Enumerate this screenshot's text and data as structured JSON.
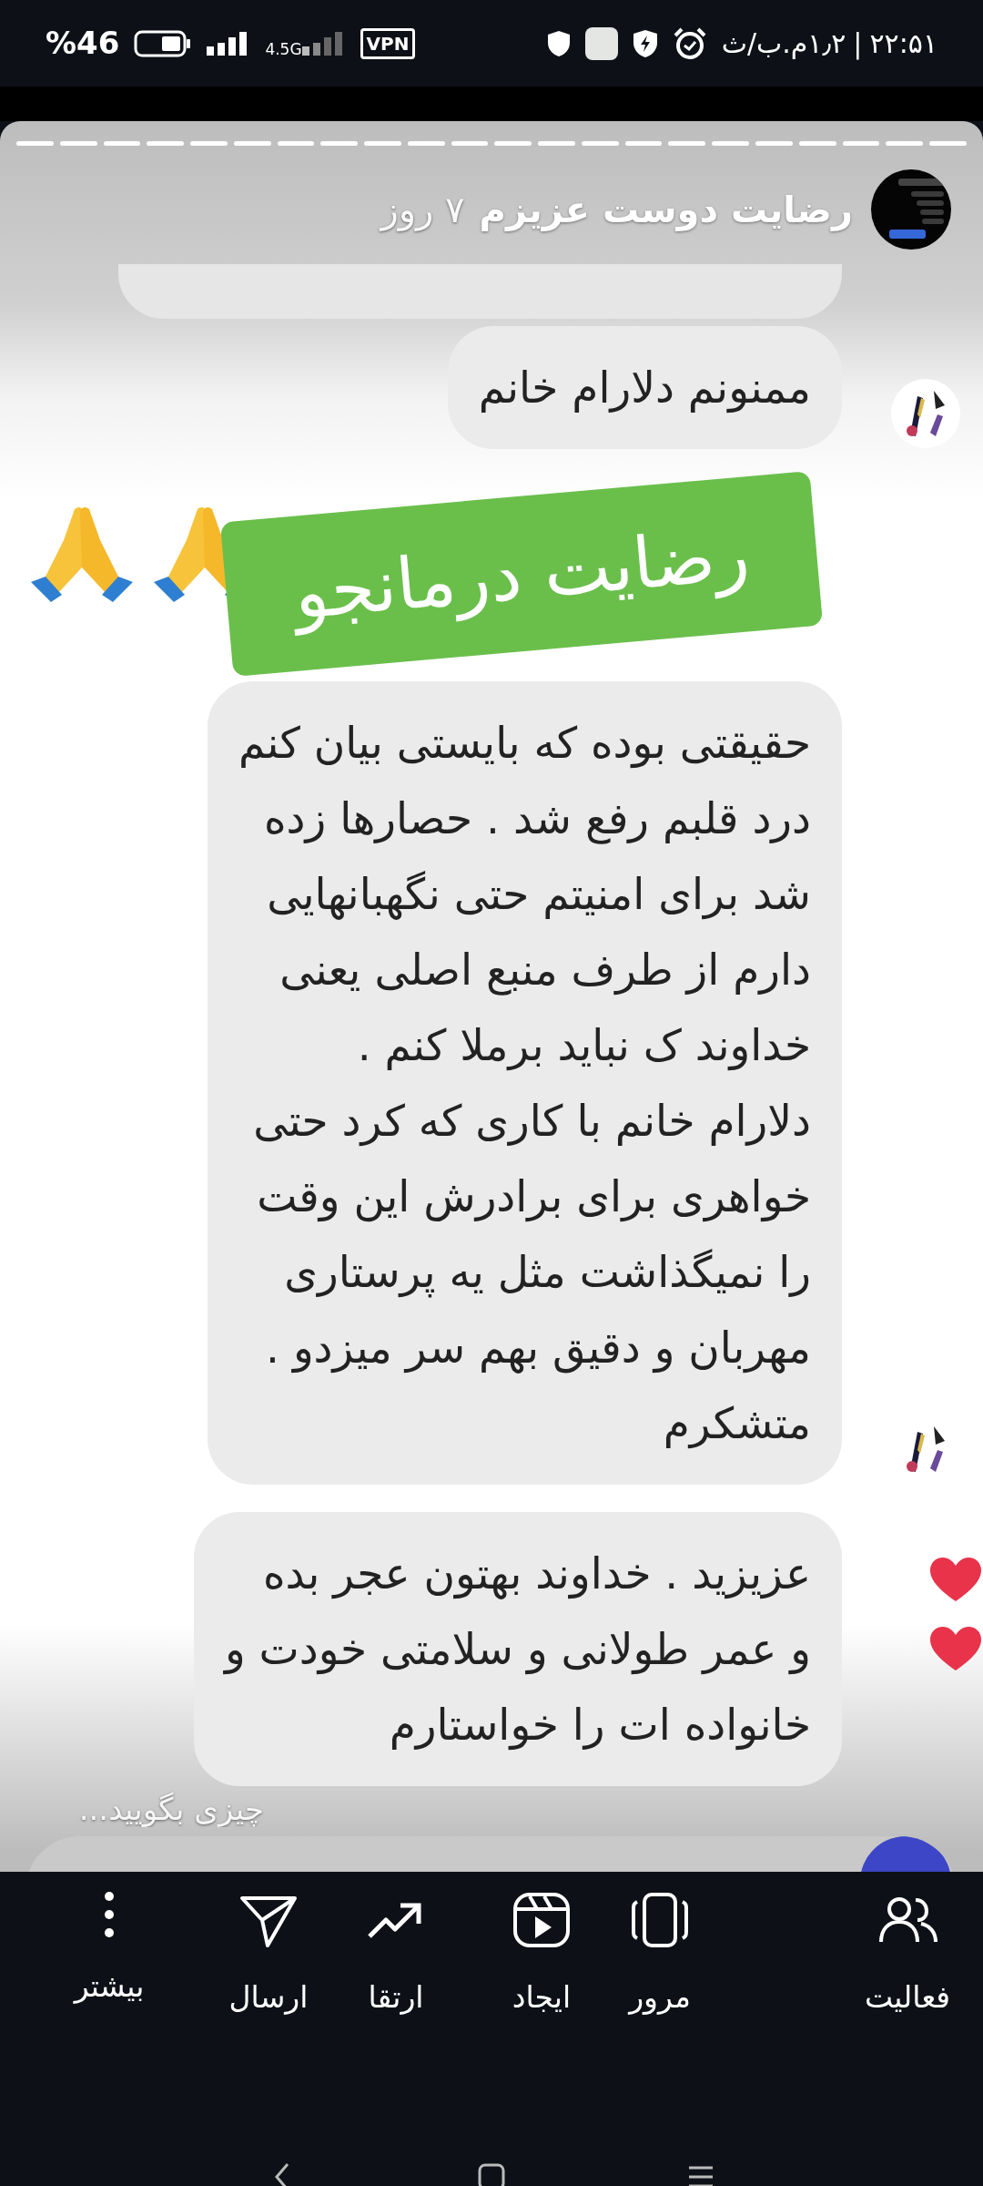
{
  "status_bar": {
    "time": "۲۲:۵۱",
    "separator": "|",
    "network_speed": "۱٫۲م.ب/ث",
    "network_type": "4.5G",
    "vpn": "VPN",
    "battery_percent": "%46"
  },
  "story": {
    "title": "رضایت دوست عزیزم",
    "age": "۷ روز"
  },
  "content": [
    {
      "kind": "cut"
    },
    {
      "kind": "bubble",
      "lines": [
        "ممنونم دلارام خانم"
      ],
      "avatar": true
    },
    {
      "kind": "sticker",
      "text": "رضایت درمانجو"
    },
    {
      "kind": "bubble",
      "lines": [
        "حقیقتی بوده که بایستی بیان کنم",
        "درد قلبم رفع شد . حصارها زده",
        "شد برای امنیتم حتی نگهبانهایی",
        "دارم از طرف منبع اصلی یعنی",
        "خداوند ک نباید برملا کنم .",
        "دلارام خانم با کاری که کرد حتی",
        "خواهری برای برادرش این وقت",
        "را نمیگذاشت مثل یه پرستاری",
        "مهربان و دقیق بهم سر میزدو .",
        "متشکرم"
      ],
      "avatar": true
    },
    {
      "kind": "bubble",
      "lines": [
        "عزیزید . خداوند بهتون عجر بده",
        "و عمر طولانی و سلامتی خودت و",
        "خانواده ات را خواستارم"
      ],
      "hearts": true
    }
  ],
  "reply": {
    "placeholder": "چیزی بگویید..."
  },
  "bottom_bar": [
    {
      "kind": "activity",
      "label": "فعالیت"
    },
    {
      "kind": "review",
      "label": "مرور"
    },
    {
      "kind": "create",
      "label": "ایجاد"
    },
    {
      "kind": "boost",
      "label": "ارتقا"
    },
    {
      "kind": "send",
      "label": "ارسال"
    },
    {
      "kind": "more",
      "label": "بیشتر"
    }
  ]
}
